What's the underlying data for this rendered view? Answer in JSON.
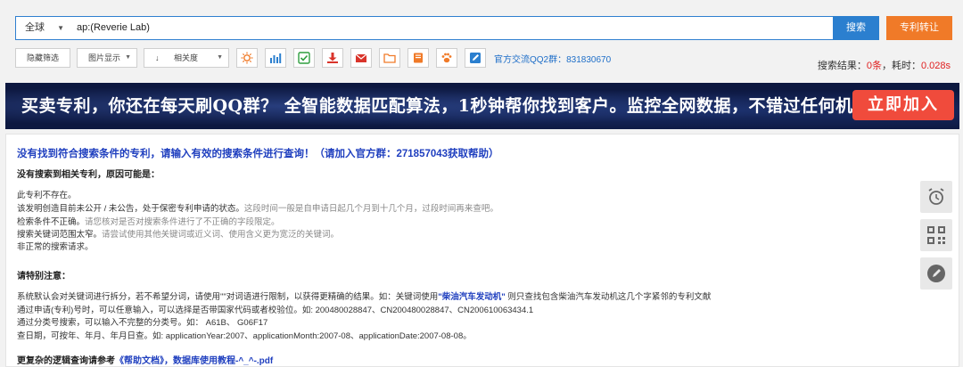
{
  "search": {
    "scope": "全球",
    "query": "ap:(Reverie Lab)",
    "search_button": "搜索",
    "transfer_button": "专利转让"
  },
  "toolbar": {
    "hide_filter": "隐藏筛选",
    "image_display": "图片显示",
    "sort": "相关度",
    "icons": [
      "sun-icon",
      "bar-chart-icon",
      "check-icon",
      "download-icon",
      "email-icon",
      "folder-icon",
      "book-icon",
      "paw-icon",
      "edit-icon"
    ],
    "qq_group": "官方交流QQ2群：831830670"
  },
  "result_stats": {
    "label": "搜索结果：",
    "count": "0条",
    "time_label": "，耗时：",
    "time": "0.028s"
  },
  "banner": {
    "text": "买卖专利，你还在每天刷QQ群？ 全智能数据匹配算法，1秒钟帮你找到客户。监控全网数据，不错过任何机会。",
    "cta": "立即加入"
  },
  "notice": {
    "headline": "没有找到符合搜索条件的专利，请输入有效的搜索条件进行查询！（请加入官方群：271857043获取帮助）",
    "reasons_title": "没有搜索到相关专利，原因可能是：",
    "reasons": [
      {
        "main": "此专利不存在。",
        "detail": ""
      },
      {
        "main": "该发明创造目前未公开 / 未公告，处于保密专利申请的状态。",
        "detail": "这段时间一般是自申请日起几个月到十几个月，过段时间再来查吧。"
      },
      {
        "main": "检索条件不正确。",
        "detail": "请您核对是否对搜索条件进行了不正确的字段限定。"
      },
      {
        "main": "搜索关键词范围太窄。",
        "detail": "请尝试使用其他关键词或近义词、使用含义更为宽泛的关键词。"
      },
      {
        "main": "非正常的搜索请求。",
        "detail": ""
      }
    ],
    "tips_title": "请特别注意：",
    "tip1_prefix": "系统默认会对关键词进行拆分，若不希望分词，请使用\"\"对词语进行限制，以获得更精确的结果。如：关键词使用",
    "tip1_highlight": "\"柴油汽车发动机\"",
    "tip1_suffix": " 则只查找包含柴油汽车发动机这几个字紧邻的专利文献",
    "tip2": "通过申请(专利)号时，可以任意输入，可以选择是否带国家代码或者校验位。如: 200480028847、CN200480028847、CN200610063434.1",
    "tip3": "通过分类号搜索，可以输入不完整的分类号。如： A61B、 G06F17",
    "tip4": "查日期，可按年、年月、年月日查。如: applicationYear:2007、applicationMonth:2007-08、applicationDate:2007-08-08。",
    "more_prefix": "更复杂的逻辑查询请参考",
    "help_doc": "《帮助文档》",
    "tutorial": "，数据库使用教程-^_^-.pdf"
  },
  "sidebar": {
    "icons": [
      "alarm-icon",
      "qr-code-icon",
      "edit-icon"
    ]
  }
}
